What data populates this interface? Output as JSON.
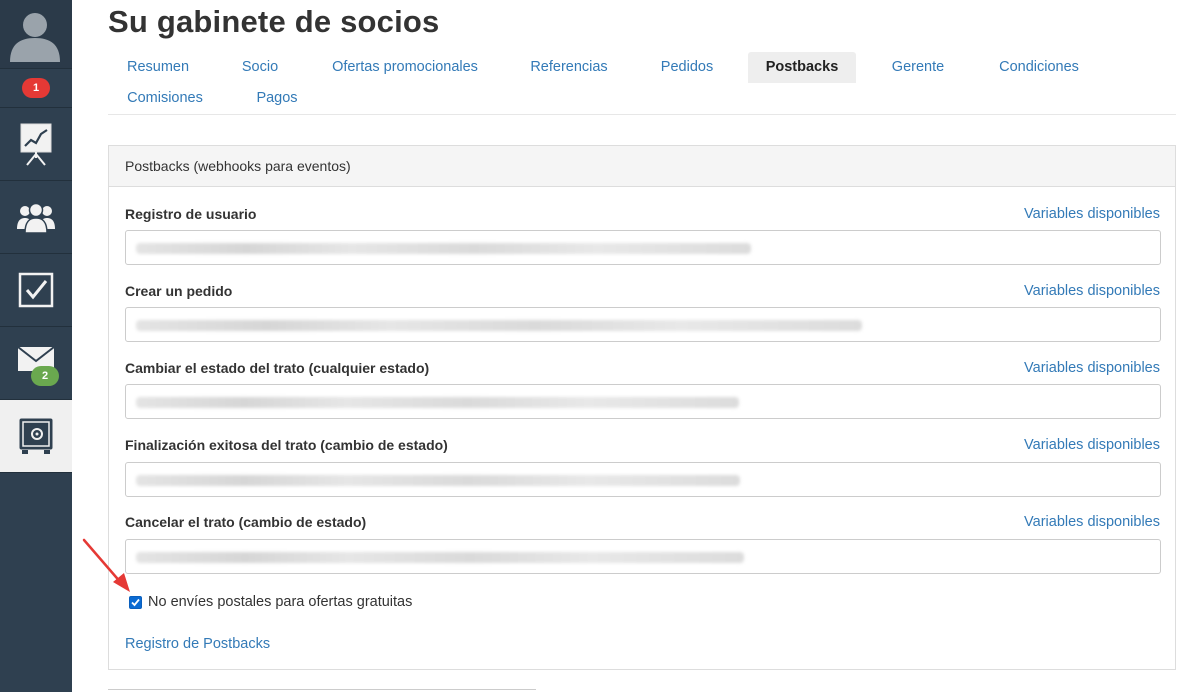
{
  "sidebar": {
    "notifications_badge": "1",
    "messages_badge": "2",
    "items": [
      {
        "icon": "statistics-chart-icon"
      },
      {
        "icon": "users-group-icon"
      },
      {
        "icon": "checkbox-tasks-icon"
      },
      {
        "icon": "envelope-icon"
      },
      {
        "icon": "safe-icon"
      }
    ]
  },
  "page_title": "Su gabinete de socios",
  "tabs": [
    {
      "label": "Resumen"
    },
    {
      "label": "Socio"
    },
    {
      "label": "Ofertas promocionales"
    },
    {
      "label": "Referencias"
    },
    {
      "label": "Pedidos"
    },
    {
      "label": "Postbacks",
      "active": true
    },
    {
      "label": "Gerente"
    },
    {
      "label": "Condiciones"
    },
    {
      "label": "Comisiones"
    },
    {
      "label": "Pagos"
    }
  ],
  "panel": {
    "heading": "Postbacks (webhooks para eventos)",
    "variables_link": "Variables disponibles",
    "fields": [
      {
        "label": "Registro de usuario"
      },
      {
        "label": "Crear un pedido"
      },
      {
        "label": "Cambiar el estado del trato (cualquier estado)"
      },
      {
        "label": "Finalización exitosa del trato (cambio de estado)"
      },
      {
        "label": "Cancelar el trato (cambio de estado)"
      }
    ],
    "checkbox_label": "No envíes postales para ofertas gratuitas",
    "checkbox_checked": true,
    "log_link": "Registro de Postbacks"
  },
  "colors": {
    "sidebar": "#2f4050",
    "link": "#337ab7",
    "badge_red": "#e53935",
    "badge_green": "#6aa84f",
    "checkbox": "#0b6bd3",
    "annotation_arrow": "#e53935"
  }
}
